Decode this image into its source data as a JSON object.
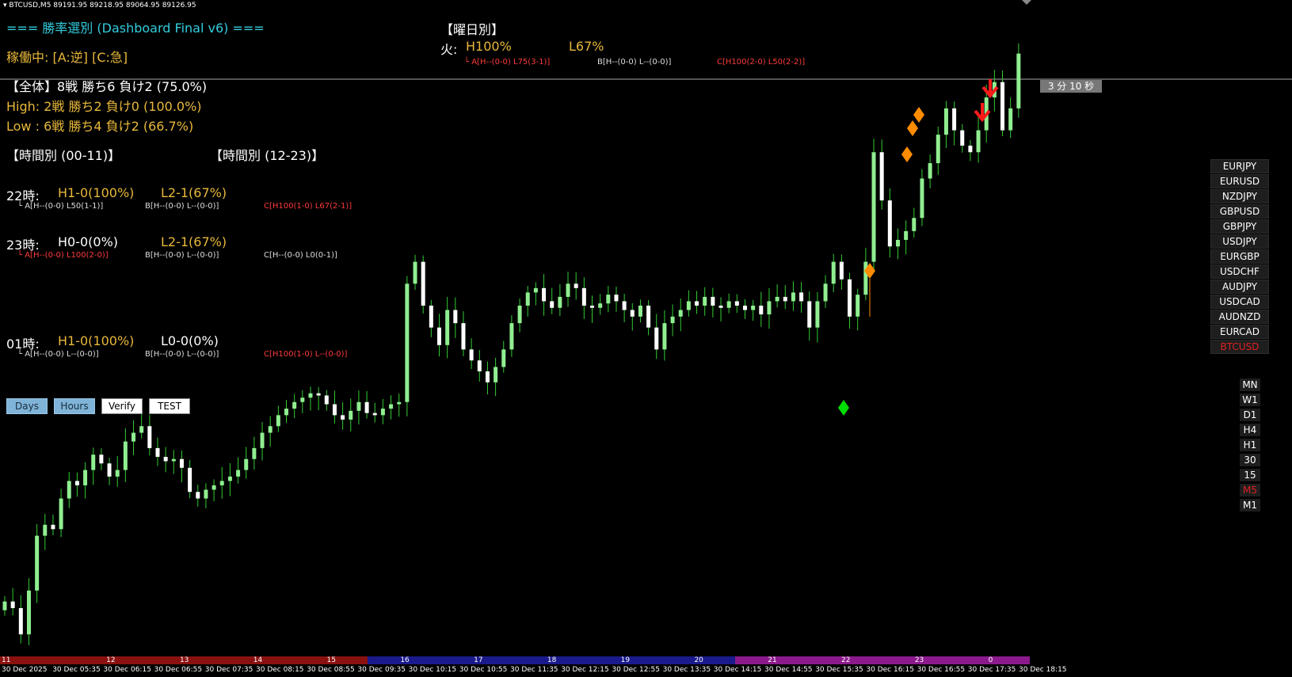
{
  "window": {
    "symbol_line": "BTCUSD,M5  89191.95 89218.95 89064.95 89126.95"
  },
  "dashboard": {
    "title": "=== 勝率選別 (Dashboard Final v6) ===",
    "status": "稼働中: [A:逆] [C:急]",
    "summary_all": "【全体】8戦 勝ち6 負け2 (75.0%)",
    "summary_high": "High: 2戦 勝ち2 負け0 (100.0%)",
    "summary_low": "Low : 6戦 勝ち4 負け2 (66.7%)",
    "hours_am_title": "【時間別 (00-11)】",
    "hours_pm_title": "【時間別 (12-23)】",
    "rows": [
      {
        "hour": "22時:",
        "h": "H1-0(100%)",
        "l": "L2-1(67%)",
        "a": "└ A[H--(0-0) L50(1-1)]",
        "b": "B[H--(0-0) L--(0-0)]",
        "c": "C[H100(1-0) L67(2-1)]"
      },
      {
        "hour": "23時:",
        "h": "H0-0(0%)",
        "l": "L2-1(67%)",
        "a": "└ A[H--(0-0) L100(2-0)]",
        "b": "B[H--(0-0) L--(0-0)]",
        "c": "C[H--(0-0) L0(0-1)]"
      },
      {
        "hour": "01時:",
        "h": "H1-0(100%)",
        "l": "L0-0(0%)",
        "a": "└ A[H--(0-0) L--(0-0)]",
        "b": "B[H--(0-0) L--(0-0)]",
        "c": "C[H100(1-0) L--(0-0)]"
      }
    ],
    "buttons": {
      "days": "Days",
      "hours": "Hours",
      "verify": "Verify",
      "test": "TEST"
    },
    "weekday_title": "【曜日別】",
    "weekday_day": "火:",
    "weekday_h": "H100%",
    "weekday_l": "L67%",
    "weekday_a": "└   A[H--(0-0) L75(3-1)]",
    "weekday_b": "B[H--(0-0) L--(0-0)]",
    "weekday_c": "C[H100(2-0) L50(2-2)]"
  },
  "timer": "3 分 10 秒",
  "pairs": [
    "EURJPY",
    "EURUSD",
    "NZDJPY",
    "GBPUSD",
    "GBPJPY",
    "USDJPY",
    "EURGBP",
    "USDCHF",
    "AUDJPY",
    "USDCAD",
    "AUDNZD",
    "EURCAD",
    "BTCUSD"
  ],
  "active_pair": "BTCUSD",
  "timeframes": [
    "MN",
    "W1",
    "D1",
    "H4",
    "H1",
    "30",
    "15",
    "M5",
    "M1"
  ],
  "active_timeframe": "M5",
  "sessions": [
    {
      "label": "11",
      "color": "#8b1010"
    },
    {
      "label": "12",
      "color": "#8b1010"
    },
    {
      "label": "13",
      "color": "#8b1010"
    },
    {
      "label": "14",
      "color": "#8b1010"
    },
    {
      "label": "15",
      "color": "#8b1010"
    },
    {
      "label": "16",
      "color": "#1a1a8c"
    },
    {
      "label": "17",
      "color": "#1a1a8c"
    },
    {
      "label": "18",
      "color": "#1a1a8c"
    },
    {
      "label": "19",
      "color": "#1a1a8c"
    },
    {
      "label": "20",
      "color": "#1a1a8c"
    },
    {
      "label": "21",
      "color": "#8c1a8c"
    },
    {
      "label": "22",
      "color": "#8c1a8c"
    },
    {
      "label": "23",
      "color": "#8c1a8c"
    },
    {
      "label": "0",
      "color": "#8c1a8c"
    }
  ],
  "time_labels": [
    "30 Dec 2025",
    "30 Dec 05:35",
    "30 Dec 06:15",
    "30 Dec 06:55",
    "30 Dec 07:35",
    "30 Dec 08:15",
    "30 Dec 08:55",
    "30 Dec 09:35",
    "30 Dec 10:15",
    "30 Dec 10:55",
    "30 Dec 11:35",
    "30 Dec 12:15",
    "30 Dec 12:55",
    "30 Dec 13:35",
    "30 Dec 14:15",
    "30 Dec 14:55",
    "30 Dec 15:35",
    "30 Dec 16:15",
    "30 Dec 16:55",
    "30 Dec 17:35",
    "30 Dec 18:15"
  ],
  "colors": {
    "up": "#90ee90",
    "down": "#ffffff",
    "wick": "#33cc33",
    "signal_orange": "#ff8c00",
    "signal_green": "#00dd00",
    "arrow_red": "#ff1a1a"
  },
  "candle_closes": [
    87350,
    87320,
    87200,
    87400,
    87650,
    87700,
    87680,
    87820,
    87900,
    87880,
    87950,
    88020,
    87980,
    87920,
    87950,
    88080,
    88120,
    88150,
    88050,
    88010,
    87990,
    88000,
    87960,
    87850,
    87820,
    87860,
    87880,
    87900,
    87920,
    87950,
    88000,
    88050,
    88120,
    88150,
    88200,
    88230,
    88260,
    88280,
    88300,
    88290,
    88250,
    88200,
    88180,
    88220,
    88260,
    88210,
    88200,
    88230,
    88250,
    88260,
    88800,
    88900,
    88700,
    88600,
    88520,
    88680,
    88620,
    88500,
    88450,
    88400,
    88350,
    88420,
    88500,
    88620,
    88700,
    88760,
    88780,
    88720,
    88690,
    88740,
    88800,
    88780,
    88700,
    88690,
    88710,
    88750,
    88720,
    88680,
    88650,
    88700,
    88600,
    88500,
    88620,
    88650,
    88680,
    88720,
    88700,
    88740,
    88700,
    88690,
    88720,
    88700,
    88680,
    88700,
    88660,
    88720,
    88740,
    88720,
    88760,
    88720,
    88600,
    88720,
    88800,
    88900,
    88820,
    88650,
    88750,
    88900,
    89400,
    89180,
    88970,
    89000,
    89040,
    89100,
    89280,
    89350,
    89480,
    89600,
    89500,
    89430,
    89400,
    89500,
    89650,
    89720,
    89500,
    89600,
    89850
  ]
}
